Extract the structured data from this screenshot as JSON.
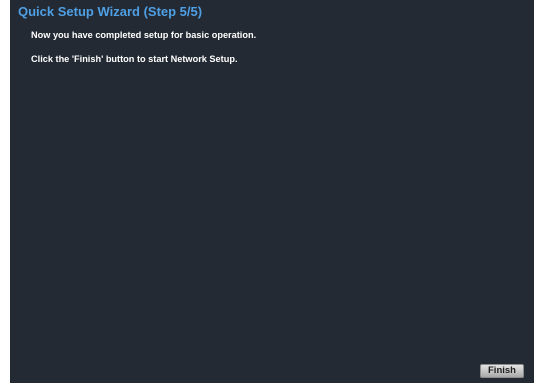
{
  "wizard": {
    "title": "Quick Setup Wizard (Step 5/5)",
    "messages": [
      "Now you have completed setup for basic operation.",
      "Click the 'Finish' button to start Network Setup."
    ],
    "finish_label": "Finish"
  },
  "colors": {
    "background": "#232a33",
    "title": "#4f9fe5",
    "text": "#ffffff"
  }
}
